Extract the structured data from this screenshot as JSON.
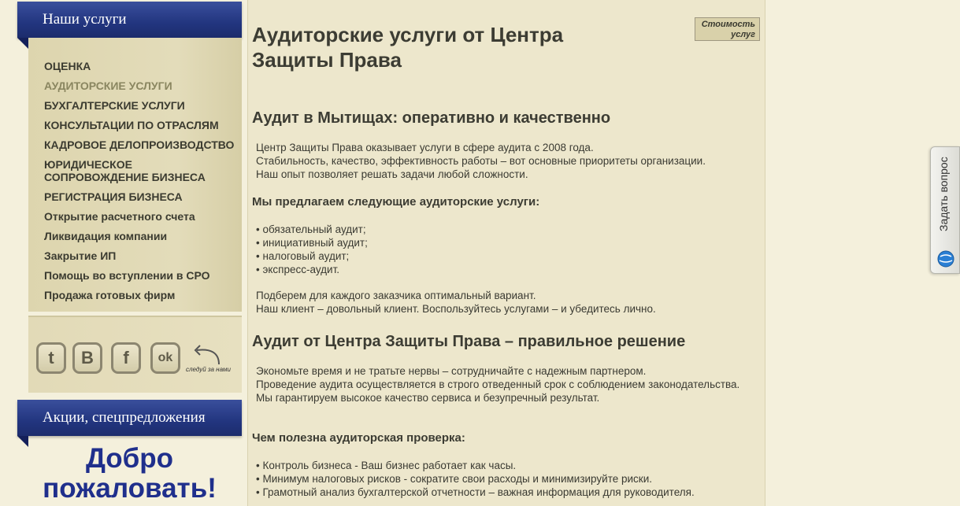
{
  "sidebar": {
    "services_title": "Наши услуги",
    "menu": [
      {
        "label": "ОЦЕНКА",
        "active": false
      },
      {
        "label": "АУДИТОРСКИЕ УСЛУГИ",
        "active": true
      },
      {
        "label": "БУХГАЛТЕРСКИЕ УСЛУГИ",
        "active": false
      },
      {
        "label": "КОНСУЛЬТАЦИИ ПО ОТРАСЛЯМ",
        "active": false
      },
      {
        "label": "КАДРОВОЕ ДЕЛОПРОИЗВОДСТВО",
        "active": false
      },
      {
        "label": "ЮРИДИЧЕСКОЕ СОПРОВОЖДЕНИЕ БИЗНЕСА",
        "active": false
      },
      {
        "label": "РЕГИСТРАЦИЯ БИЗНЕСА",
        "active": false
      },
      {
        "label": "Открытие расчетного счета",
        "active": false
      },
      {
        "label": "Ликвидация компании",
        "active": false
      },
      {
        "label": "Закрытие ИП",
        "active": false
      },
      {
        "label": "Помощь во вступлении в СРО",
        "active": false
      },
      {
        "label": "Продажа готовых фирм",
        "active": false
      }
    ],
    "social": {
      "twitter": "t",
      "vk": "B",
      "facebook": "f",
      "odnoklassniki": "ok",
      "follow_label": "следуй за нами"
    },
    "promo_title": "Акции, спецпредложения",
    "welcome_line1": "Добро",
    "welcome_line2": "пожаловать!"
  },
  "content": {
    "title": "Аудиторские услуги от Центра Защиты Права",
    "price_button": "Стоимость услуг",
    "h2_1": "Аудит в Мытищах: оперативно и качественно",
    "intro": [
      "Центр Защиты Права оказывает услуги в сфере аудита с 2008 года.",
      "Стабильность, качество, эффективность работы – вот основные приоритеты организации.",
      "Наш опыт позволяет решать задачи любой сложности."
    ],
    "h3_1": "Мы предлагаем следующие аудиторские услуги:",
    "services": [
      "• обязательный аудит;",
      "• инициативный аудит;",
      "• налоговый аудит;",
      "• экспресс-аудит."
    ],
    "offer": [
      "Подберем для каждого заказчика оптимальный вариант.",
      "Наш клиент – довольный клиент. Воспользуйтесь услугами – и убедитесь лично."
    ],
    "h2_2": "Аудит от Центра Защиты Права – правильное решение",
    "reasons": [
      "Экономьте время и не тратьте нервы – сотрудничайте с надежным партнером.",
      "Проведение аудита осуществляется в строго отведенный срок с соблюдением законодательства.",
      "Мы гарантируем высокое качество сервиса и безупречный результат."
    ],
    "h3_2": "Чем полезна аудиторская проверка:",
    "benefits": [
      "• Контроль бизнеса - Ваш бизнес работает как часы.",
      "• Минимум налоговых рисков - сократите свои расходы и минимизируйте риски.",
      "• Грамотный анализ бухгалтерской отчетности – важная информация для руководителя."
    ]
  },
  "ask_tab": {
    "label": "Задать вопрос"
  },
  "colors": {
    "ribbon": "#22357f",
    "welcome": "#1f2f8c",
    "background": "#f4f0dc"
  }
}
